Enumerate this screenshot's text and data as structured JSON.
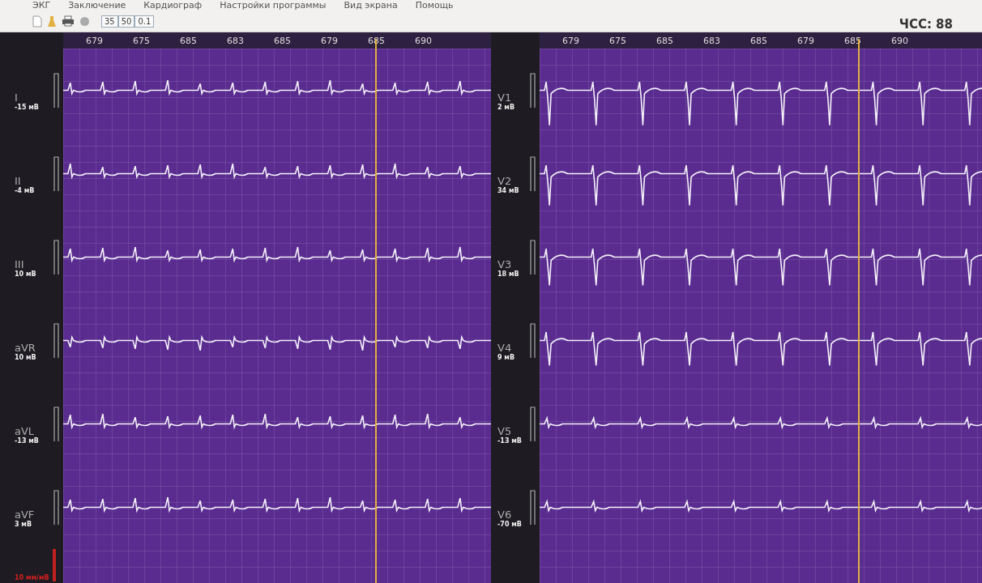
{
  "menu": [
    "ЭКГ",
    "Заключение",
    "Кардиограф",
    "Настройки программы",
    "Вид экрана",
    "Помощь"
  ],
  "toolbar": {
    "values": [
      "35",
      "50",
      "0.1"
    ]
  },
  "heart_rate": "ЧСС: 88",
  "panels": [
    {
      "intervals": [
        "679",
        "675",
        "685",
        "683",
        "685",
        "679",
        "685",
        "690"
      ],
      "leads": [
        {
          "name": "I",
          "amplitude": "-15 мВ"
        },
        {
          "name": "II",
          "amplitude": "-4 мВ"
        },
        {
          "name": "III",
          "amplitude": "10 мВ"
        },
        {
          "name": "aVR",
          "amplitude": "10 мВ"
        },
        {
          "name": "aVL",
          "amplitude": "-13 мВ"
        },
        {
          "name": "aVF",
          "amplitude": "3 мВ"
        }
      ]
    },
    {
      "intervals": [
        "679",
        "675",
        "685",
        "683",
        "685",
        "679",
        "685",
        "690"
      ],
      "leads": [
        {
          "name": "V1",
          "amplitude": "2 мВ"
        },
        {
          "name": "V2",
          "amplitude": "34 мВ"
        },
        {
          "name": "V3",
          "amplitude": "18 мВ"
        },
        {
          "name": "V4",
          "amplitude": "9 мВ"
        },
        {
          "name": "V5",
          "amplitude": "-13 мВ"
        },
        {
          "name": "V6",
          "amplitude": "-70 мВ"
        }
      ]
    }
  ],
  "scale": "10 мм/мВ"
}
